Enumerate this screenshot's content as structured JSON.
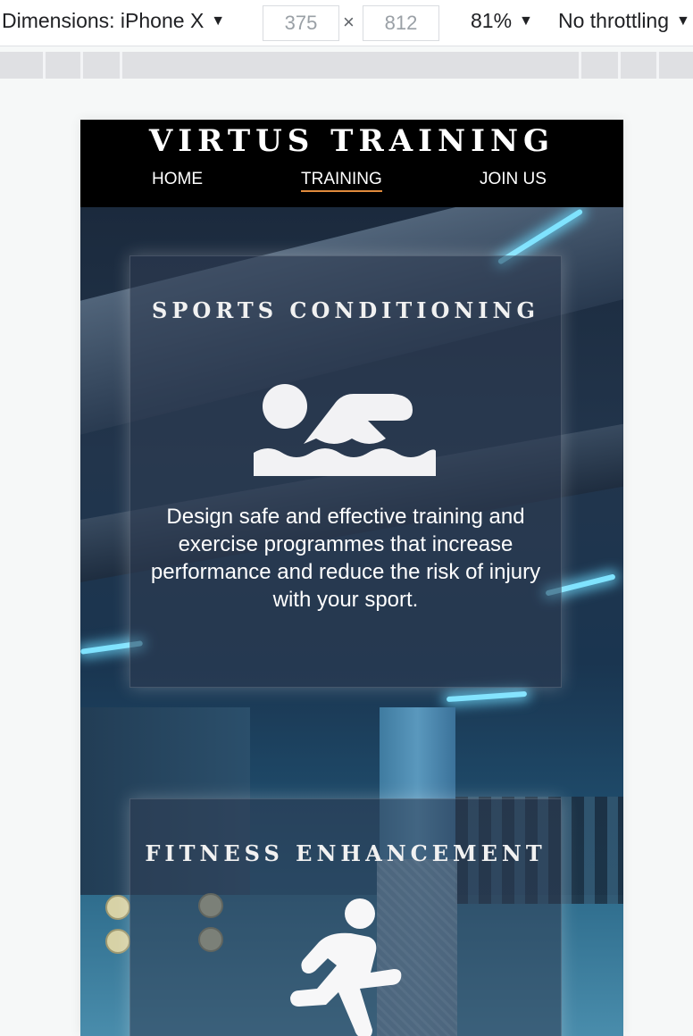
{
  "devtools": {
    "dimensions_label": "Dimensions: iPhone X",
    "width_value": "375",
    "height_value": "812",
    "times_sign": "×",
    "zoom_label": "81%",
    "throttling_label": "No throttling",
    "caret": "▼"
  },
  "site": {
    "brand": "VIRTUS TRAINING",
    "nav": [
      {
        "label": "HOME",
        "active": false
      },
      {
        "label": "TRAINING",
        "active": true
      },
      {
        "label": "JOIN US",
        "active": false
      }
    ],
    "accent_color": "#e08a3c"
  },
  "cards": [
    {
      "title": "SPORTS CONDITIONING",
      "icon": "swimmer-icon",
      "text": "Design safe and effective training and exercise programmes that increase performance and reduce the risk of injury with your sport."
    },
    {
      "title": "FITNESS ENHANCEMENT",
      "icon": "runner-icon"
    }
  ]
}
